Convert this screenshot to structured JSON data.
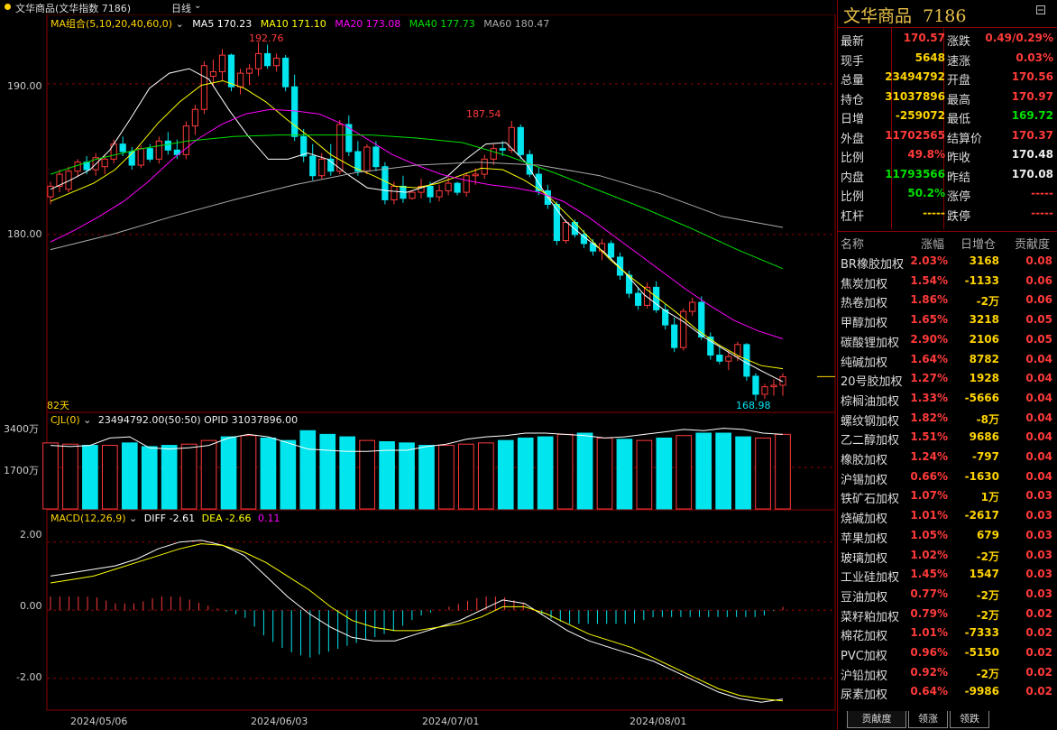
{
  "window": {
    "title": "文华商品(文华指数 7186)",
    "period": "日线"
  },
  "ma_legend": {
    "label": "MA组合(5,10,20,40,60,0)",
    "items": [
      {
        "text": "MA5 170.23",
        "color": "#ffffff"
      },
      {
        "text": "MA10 171.10",
        "color": "#ffff00"
      },
      {
        "text": "MA20 173.08",
        "color": "#ff00ff"
      },
      {
        "text": "MA40 177.73",
        "color": "#00e000"
      },
      {
        "text": "MA60 180.47",
        "color": "#aaaaaa"
      }
    ]
  },
  "price_axis": [
    "190.00",
    "180.00"
  ],
  "vol_axis": [
    "3400万",
    "1700万"
  ],
  "macd_axis": [
    "2.00",
    "0.00",
    "-2.00"
  ],
  "date_axis": [
    "2024/05/06",
    "2024/06/03",
    "2024/07/01",
    "2024/08/01"
  ],
  "annotations": {
    "high1": "192.76",
    "high2": "187.54",
    "low": "168.98",
    "days": "82天"
  },
  "cjl": {
    "label": "CJL(0)",
    "values": "23494792.00(50:50)  OPID 31037896.00"
  },
  "macd": {
    "label": "MACD(12,26,9)",
    "diff": "DIFF -2.61",
    "dea": "DEA -2.66",
    "macd": "0.11"
  },
  "colors": {
    "up": "#ff3a3a",
    "down": "#00e5ee",
    "panel_border": "#8b0000",
    "accent_gold": "#e8c048"
  },
  "panel": {
    "name": "文华商品",
    "code": "7186",
    "quote_left": [
      {
        "label": "最新",
        "value": "170.57",
        "color": "red"
      },
      {
        "label": "现手",
        "value": "5648",
        "color": "yel"
      },
      {
        "label": "总量",
        "value": "23494792",
        "color": "yel"
      },
      {
        "label": "持仓",
        "value": "31037896",
        "color": "yel"
      },
      {
        "label": "日增",
        "value": "-259072",
        "color": "yel"
      },
      {
        "label": "外盘",
        "value": "11702565",
        "color": "red"
      },
      {
        "label": "比例",
        "value": "49.8%",
        "color": "red"
      },
      {
        "label": "内盘",
        "value": "11793566",
        "color": "grn"
      },
      {
        "label": "比例",
        "value": "50.2%",
        "color": "grn"
      },
      {
        "label": "杠杆",
        "value": "-----",
        "color": "yel"
      }
    ],
    "quote_right": [
      {
        "label": "涨跌",
        "value": "0.49/0.29%",
        "color": "red"
      },
      {
        "label": "速涨",
        "value": "0.03%",
        "color": "red"
      },
      {
        "label": "开盘",
        "value": "170.56",
        "color": "red"
      },
      {
        "label": "最高",
        "value": "170.97",
        "color": "red"
      },
      {
        "label": "最低",
        "value": "169.72",
        "color": "grn"
      },
      {
        "label": "结算价",
        "value": "170.37",
        "color": "red"
      },
      {
        "label": "昨收",
        "value": "170.48",
        "color": "wht"
      },
      {
        "label": "昨结",
        "value": "170.08",
        "color": "wht"
      },
      {
        "label": "涨停",
        "value": "-----",
        "color": "red"
      },
      {
        "label": "跌停",
        "value": "-----",
        "color": "red"
      }
    ],
    "rank_header": [
      "名称",
      "涨幅",
      "日增仓",
      "贡献度"
    ],
    "rank_rows": [
      [
        "BR橡胶加权",
        "2.03%",
        "3168",
        "0.08"
      ],
      [
        "焦炭加权",
        "1.54%",
        "-1133",
        "0.06"
      ],
      [
        "热卷加权",
        "1.86%",
        "-2万",
        "0.06"
      ],
      [
        "甲醇加权",
        "1.65%",
        "3218",
        "0.05"
      ],
      [
        "碳酸锂加权",
        "2.90%",
        "2106",
        "0.05"
      ],
      [
        "纯碱加权",
        "1.64%",
        "8782",
        "0.04"
      ],
      [
        "20号胶加权",
        "1.27%",
        "1928",
        "0.04"
      ],
      [
        "棕榈油加权",
        "1.33%",
        "-5666",
        "0.04"
      ],
      [
        "螺纹钢加权",
        "1.82%",
        "-8万",
        "0.04"
      ],
      [
        "乙二醇加权",
        "1.51%",
        "9686",
        "0.04"
      ],
      [
        "橡胶加权",
        "1.24%",
        "-797",
        "0.04"
      ],
      [
        "沪锡加权",
        "0.66%",
        "-1630",
        "0.04"
      ],
      [
        "铁矿石加权",
        "1.07%",
        "1万",
        "0.03"
      ],
      [
        "烧碱加权",
        "1.01%",
        "-2617",
        "0.03"
      ],
      [
        "苹果加权",
        "1.05%",
        "679",
        "0.03"
      ],
      [
        "玻璃加权",
        "1.02%",
        "-2万",
        "0.03"
      ],
      [
        "工业硅加权",
        "1.45%",
        "1547",
        "0.03"
      ],
      [
        "豆油加权",
        "0.77%",
        "-2万",
        "0.03"
      ],
      [
        "菜籽粕加权",
        "0.79%",
        "-2万",
        "0.02"
      ],
      [
        "棉花加权",
        "1.01%",
        "-7333",
        "0.02"
      ],
      [
        "PVC加权",
        "0.96%",
        "-5150",
        "0.02"
      ],
      [
        "沪铅加权",
        "0.92%",
        "-2万",
        "0.02"
      ],
      [
        "尿素加权",
        "0.64%",
        "-9986",
        "0.02"
      ]
    ],
    "tabs": [
      "贡献度",
      "领涨",
      "领跌"
    ]
  },
  "chart_data": {
    "type": "candlestick",
    "title": "文华商品(文华指数 7186)",
    "period": "日线",
    "candles": [
      [
        182.5,
        183.5,
        182.0,
        183.2
      ],
      [
        183.2,
        184.3,
        182.8,
        184.0
      ],
      [
        183.0,
        184.5,
        182.8,
        184.2
      ],
      [
        184.2,
        185.0,
        183.8,
        184.8
      ],
      [
        184.8,
        185.2,
        184.0,
        184.3
      ],
      [
        184.3,
        185.4,
        183.9,
        185.1
      ],
      [
        184.5,
        185.3,
        184.0,
        185.0
      ],
      [
        185.0,
        186.3,
        184.7,
        186.0
      ],
      [
        186.0,
        186.5,
        185.2,
        185.5
      ],
      [
        185.5,
        185.8,
        184.3,
        184.6
      ],
      [
        184.6,
        185.9,
        184.4,
        185.7
      ],
      [
        185.7,
        186.0,
        184.8,
        185.0
      ],
      [
        185.0,
        186.5,
        184.7,
        186.2
      ],
      [
        186.2,
        186.8,
        185.3,
        185.6
      ],
      [
        185.6,
        186.3,
        185.0,
        185.3
      ],
      [
        185.3,
        187.5,
        185.0,
        187.2
      ],
      [
        187.2,
        188.6,
        186.6,
        188.3
      ],
      [
        188.3,
        191.5,
        188.0,
        191.2
      ],
      [
        190.5,
        191.6,
        189.8,
        190.8
      ],
      [
        190.8,
        192.3,
        190.2,
        191.9
      ],
      [
        191.9,
        192.0,
        189.5,
        189.8
      ],
      [
        189.8,
        191.0,
        189.3,
        190.7
      ],
      [
        190.7,
        191.3,
        189.9,
        191.0
      ],
      [
        191.0,
        192.76,
        190.5,
        192.0
      ],
      [
        192.0,
        192.6,
        191.0,
        191.2
      ],
      [
        191.2,
        192.0,
        190.8,
        191.7
      ],
      [
        191.7,
        191.9,
        189.5,
        189.8
      ],
      [
        189.8,
        190.6,
        186.2,
        186.5
      ],
      [
        186.5,
        187.0,
        184.8,
        185.2
      ],
      [
        185.2,
        186.0,
        183.6,
        183.9
      ],
      [
        183.9,
        185.4,
        183.7,
        185.0
      ],
      [
        185.0,
        186.0,
        183.9,
        184.2
      ],
      [
        184.2,
        187.6,
        184.0,
        187.3
      ],
      [
        187.3,
        187.9,
        185.2,
        185.5
      ],
      [
        185.5,
        186.2,
        183.9,
        184.2
      ],
      [
        184.2,
        186.0,
        184.0,
        185.8
      ],
      [
        185.8,
        186.2,
        184.2,
        184.5
      ],
      [
        184.5,
        184.8,
        182.0,
        182.3
      ],
      [
        182.3,
        183.5,
        182.0,
        183.2
      ],
      [
        183.2,
        183.9,
        182.1,
        182.4
      ],
      [
        182.4,
        182.9,
        182.3,
        182.8
      ],
      [
        182.8,
        183.7,
        182.4,
        183.2
      ],
      [
        183.2,
        183.5,
        182.1,
        182.5
      ],
      [
        182.5,
        183.3,
        182.2,
        182.9
      ],
      [
        182.9,
        183.8,
        182.6,
        183.4
      ],
      [
        183.4,
        183.5,
        182.6,
        182.8
      ],
      [
        182.8,
        184.1,
        182.5,
        183.9
      ],
      [
        183.9,
        184.4,
        183.3,
        184.0
      ],
      [
        184.0,
        185.3,
        183.7,
        185.0
      ],
      [
        185.0,
        186.0,
        184.6,
        185.7
      ],
      [
        185.7,
        186.2,
        185.2,
        185.6
      ],
      [
        185.6,
        187.54,
        185.4,
        187.1
      ],
      [
        187.1,
        187.3,
        185.0,
        185.3
      ],
      [
        185.3,
        185.6,
        183.8,
        184.0
      ],
      [
        184.0,
        184.5,
        182.6,
        182.9
      ],
      [
        182.9,
        183.3,
        181.7,
        182.0
      ],
      [
        182.0,
        182.2,
        179.3,
        179.6
      ],
      [
        179.6,
        181.0,
        179.4,
        180.8
      ],
      [
        180.8,
        181.0,
        179.8,
        180.0
      ],
      [
        180.0,
        180.3,
        179.1,
        179.4
      ],
      [
        179.4,
        179.7,
        178.6,
        178.9
      ],
      [
        178.9,
        179.7,
        178.3,
        179.4
      ],
      [
        179.4,
        179.6,
        178.3,
        178.5
      ],
      [
        178.5,
        178.8,
        177.0,
        177.3
      ],
      [
        177.3,
        177.6,
        175.8,
        176.1
      ],
      [
        176.1,
        176.5,
        175.0,
        175.3
      ],
      [
        175.3,
        176.8,
        175.1,
        176.5
      ],
      [
        176.5,
        176.9,
        174.8,
        175.0
      ],
      [
        175.0,
        175.4,
        173.7,
        174.0
      ],
      [
        174.0,
        174.5,
        172.2,
        172.5
      ],
      [
        172.5,
        175.1,
        172.3,
        174.9
      ],
      [
        174.9,
        175.8,
        174.6,
        175.5
      ],
      [
        175.5,
        175.9,
        173.0,
        173.2
      ],
      [
        173.2,
        173.5,
        171.7,
        172.0
      ],
      [
        172.0,
        172.6,
        171.4,
        171.6
      ],
      [
        171.6,
        172.3,
        171.0,
        171.9
      ],
      [
        171.9,
        172.9,
        171.6,
        172.7
      ],
      [
        172.7,
        172.8,
        170.3,
        170.6
      ],
      [
        170.6,
        170.8,
        168.98,
        169.4
      ],
      [
        169.4,
        170.1,
        169.1,
        169.9
      ],
      [
        169.9,
        170.4,
        169.3,
        170.0
      ],
      [
        170.0,
        170.8,
        169.3,
        170.57
      ]
    ],
    "ma": {
      "MA5": [
        183.0,
        183.6,
        184.3,
        185.6,
        187.6,
        189.7,
        190.7,
        191.0,
        190.3,
        188.3,
        186.5,
        185.0,
        185.0,
        185.4,
        185.0,
        184.0,
        183.1,
        182.9,
        182.8,
        183.2,
        183.8,
        185.0,
        186.0,
        186.1,
        184.8,
        182.7,
        180.9,
        179.8,
        178.8,
        177.5,
        176.0,
        175.0,
        174.2,
        173.2,
        172.4,
        171.6,
        170.9,
        170.23
      ],
      "MA10": [
        182.2,
        182.8,
        183.4,
        184.3,
        185.7,
        187.4,
        188.8,
        189.9,
        190.2,
        189.7,
        188.8,
        187.6,
        186.5,
        185.3,
        184.5,
        183.9,
        183.2,
        183.1,
        183.4,
        183.9,
        184.4,
        184.3,
        183.6,
        182.7,
        181.3,
        179.8,
        178.3,
        177.1,
        176.0,
        174.9,
        173.7,
        172.7,
        171.9,
        171.3,
        171.1
      ],
      "MA20": [
        179.5,
        180.3,
        181.2,
        182.2,
        183.5,
        185.0,
        186.3,
        187.3,
        188.0,
        188.3,
        188.2,
        188.0,
        187.3,
        186.3,
        185.3,
        184.6,
        184.0,
        183.6,
        183.3,
        183.1,
        182.8,
        182.2,
        181.2,
        180.0,
        178.8,
        177.6,
        176.4,
        175.3,
        174.3,
        173.6,
        173.08
      ],
      "MA40": [
        184.0,
        185.0,
        185.7,
        186.2,
        186.5,
        186.6,
        186.6,
        186.6,
        186.4,
        186.1,
        185.2,
        184.1,
        182.9,
        181.7,
        180.4,
        179.0,
        177.73
      ],
      "MA60": [
        179.0,
        180.0,
        181.2,
        182.3,
        183.3,
        184.1,
        184.6,
        184.8,
        184.6,
        183.9,
        182.7,
        181.2,
        180.47
      ]
    },
    "volume": {
      "values": [
        2700,
        2650,
        2600,
        2600,
        2700,
        2550,
        2600,
        2650,
        2800,
        2950,
        3000,
        2900,
        2800,
        3200,
        3050,
        2950,
        2800,
        2750,
        2700,
        2600,
        2600,
        2650,
        2700,
        2800,
        2900,
        2950,
        3050,
        3100,
        2900,
        2850,
        2800,
        2900,
        3000,
        3100,
        3100,
        2950,
        2900,
        3050
      ],
      "open_interest": [
        2600,
        2550,
        2600,
        2900,
        2950,
        2500,
        2450,
        2500,
        2600,
        2900,
        3050,
        2950,
        2700,
        2450,
        2400,
        2350,
        2350,
        2400,
        2400,
        2550,
        2650,
        2850,
        2950,
        3000,
        3100,
        3100,
        3050,
        3000,
        2900,
        2950,
        3050,
        3150,
        3250,
        3200,
        3300,
        3250,
        3100,
        3050
      ]
    },
    "macd": {
      "diff": [
        1.0,
        1.1,
        1.2,
        1.3,
        1.5,
        1.8,
        2.0,
        2.05,
        1.9,
        1.6,
        1.0,
        0.4,
        -0.1,
        -0.5,
        -0.8,
        -0.9,
        -0.9,
        -0.7,
        -0.5,
        -0.3,
        0.0,
        0.3,
        0.2,
        -0.2,
        -0.6,
        -0.9,
        -1.1,
        -1.3,
        -1.5,
        -1.8,
        -2.1,
        -2.4,
        -2.6,
        -2.7,
        -2.61
      ],
      "dea": [
        0.8,
        0.9,
        1.0,
        1.2,
        1.4,
        1.6,
        1.8,
        1.95,
        1.9,
        1.7,
        1.4,
        1.0,
        0.6,
        0.1,
        -0.3,
        -0.5,
        -0.6,
        -0.6,
        -0.5,
        -0.4,
        -0.2,
        0.1,
        0.1,
        -0.1,
        -0.4,
        -0.7,
        -0.9,
        -1.1,
        -1.4,
        -1.7,
        -2.0,
        -2.3,
        -2.5,
        -2.6,
        -2.66
      ],
      "hist_last": 0.11
    },
    "ylim_price": [
      168.5,
      194.0
    ],
    "ylim_macd": [
      -2.8,
      2.6
    ]
  }
}
